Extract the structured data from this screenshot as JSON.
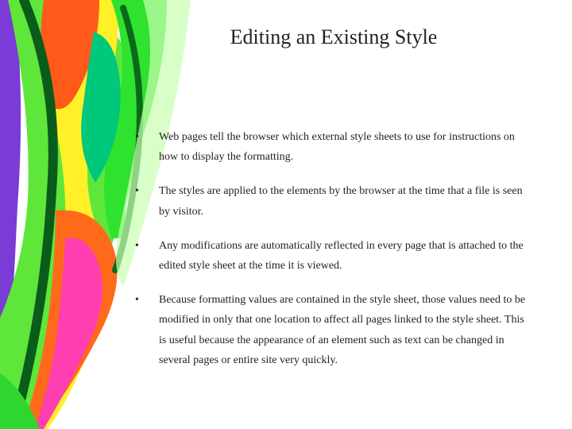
{
  "title": "Editing an Existing Style",
  "bullets": [
    "Web pages tell the browser which external style sheets to use for instructions on how to display the formatting.",
    "The styles are applied to the elements by the browser at the time that a file is seen by visitor.",
    "Any modifications are automatically reflected in every page that is attached to the edited style sheet at the time it is viewed.",
    "Because formatting values are contained in the style sheet, those values need to be modified in only that one location to affect all pages linked to the style sheet. This is useful because the appearance of an element such as text can be changed in several pages or entire site very quickly."
  ]
}
